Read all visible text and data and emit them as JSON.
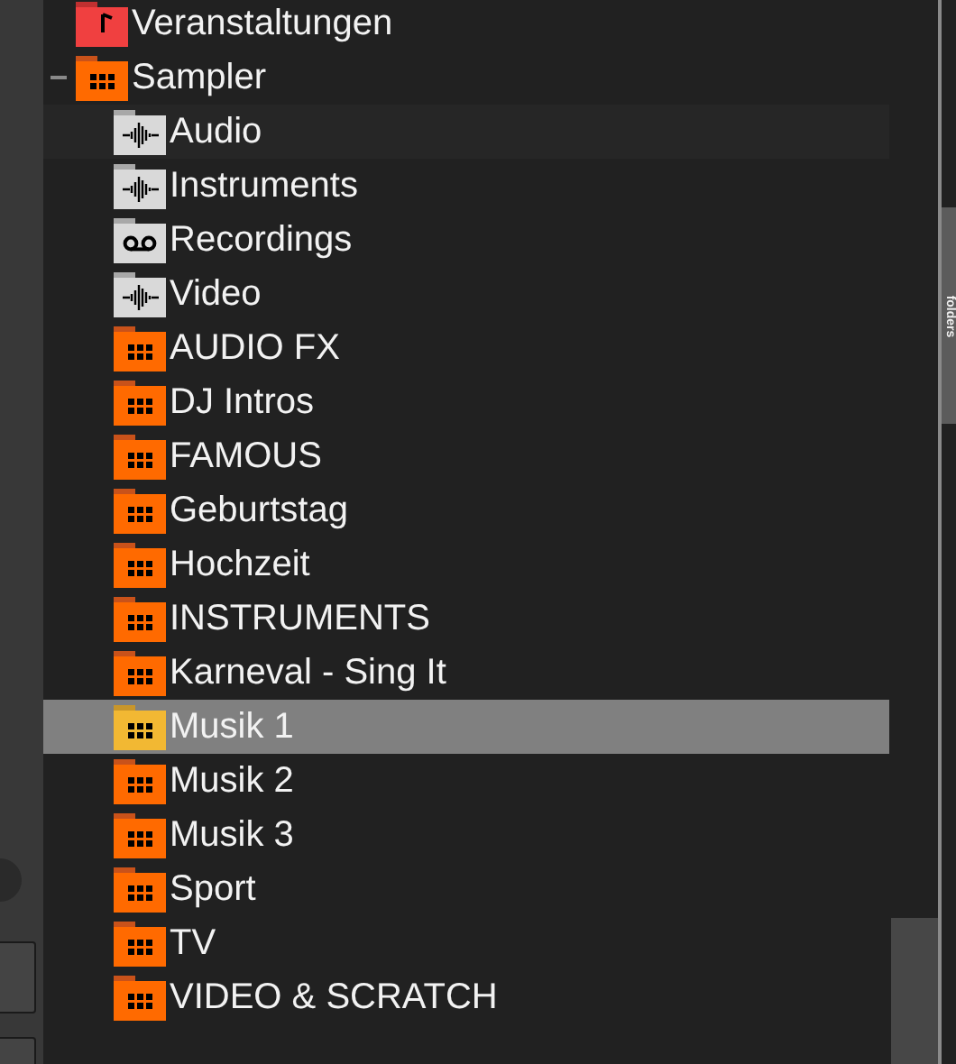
{
  "tree": {
    "items": [
      {
        "label": "Veranstaltungen",
        "kind": "music",
        "selected": false
      },
      {
        "label": "Sampler",
        "kind": "sampler",
        "selected": false,
        "expanded": true,
        "children": [
          {
            "label": "Audio",
            "kind": "audio",
            "selected": false,
            "hovered": true
          },
          {
            "label": "Instruments",
            "kind": "audio",
            "selected": false,
            "hovered": false
          },
          {
            "label": "Recordings",
            "kind": "tape",
            "selected": false,
            "hovered": false
          },
          {
            "label": "Video",
            "kind": "audio",
            "selected": false,
            "hovered": false
          },
          {
            "label": "AUDIO FX",
            "kind": "sampler",
            "selected": false,
            "hovered": false
          },
          {
            "label": "DJ Intros",
            "kind": "sampler",
            "selected": false,
            "hovered": false
          },
          {
            "label": "FAMOUS",
            "kind": "sampler",
            "selected": false,
            "hovered": false
          },
          {
            "label": "Geburtstag",
            "kind": "sampler",
            "selected": false,
            "hovered": false
          },
          {
            "label": "Hochzeit",
            "kind": "sampler",
            "selected": false,
            "hovered": false
          },
          {
            "label": "INSTRUMENTS",
            "kind": "sampler",
            "selected": false,
            "hovered": false
          },
          {
            "label": "Karneval - Sing It",
            "kind": "sampler",
            "selected": false,
            "hovered": false
          },
          {
            "label": "Musik 1",
            "kind": "sampler",
            "selected": true,
            "hovered": false
          },
          {
            "label": "Musik 2",
            "kind": "sampler",
            "selected": false,
            "hovered": false
          },
          {
            "label": "Musik 3",
            "kind": "sampler",
            "selected": false,
            "hovered": false
          },
          {
            "label": "Sport",
            "kind": "sampler",
            "selected": false,
            "hovered": false
          },
          {
            "label": "TV",
            "kind": "sampler",
            "selected": false,
            "hovered": false
          },
          {
            "label": "VIDEO & SCRATCH",
            "kind": "sampler",
            "selected": false,
            "hovered": false
          }
        ]
      }
    ]
  },
  "side_tab": {
    "label": "folders"
  }
}
